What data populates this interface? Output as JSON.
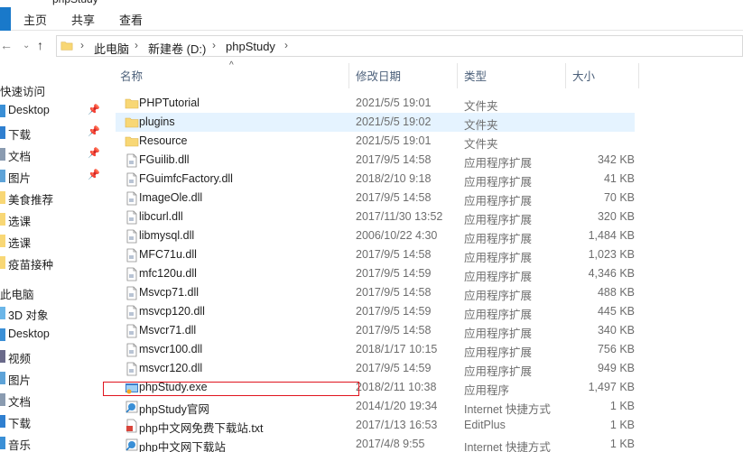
{
  "window": {
    "title": "phpStudy"
  },
  "ribbon": {
    "tabs": [
      "主页",
      "共享",
      "查看"
    ]
  },
  "address": {
    "crumbs": [
      "此电脑",
      "新建卷 (D:)",
      "phpStudy"
    ]
  },
  "nav": {
    "quick_access": "快速访问",
    "quick_items": [
      {
        "label": "Desktop",
        "pinned": true
      },
      {
        "label": "下载",
        "pinned": true
      },
      {
        "label": "文档",
        "pinned": true
      },
      {
        "label": "图片",
        "pinned": true
      },
      {
        "label": "美食推荐",
        "pinned": false
      },
      {
        "label": "选课",
        "pinned": false
      },
      {
        "label": "选课",
        "pinned": false
      },
      {
        "label": "疫苗接种",
        "pinned": false
      }
    ],
    "this_pc": "此电脑",
    "pc_items": [
      "3D 对象",
      "Desktop",
      "视频",
      "图片",
      "文档",
      "下载",
      "音乐"
    ]
  },
  "columns": {
    "name": "名称",
    "date": "修改日期",
    "type": "类型",
    "size": "大小"
  },
  "files": [
    {
      "name": "PHPTutorial",
      "date": "2021/5/5 19:01",
      "type": "文件夹",
      "size": "",
      "icon": "folder"
    },
    {
      "name": "plugins",
      "date": "2021/5/5 19:02",
      "type": "文件夹",
      "size": "",
      "icon": "folder"
    },
    {
      "name": "Resource",
      "date": "2021/5/5 19:01",
      "type": "文件夹",
      "size": "",
      "icon": "folder"
    },
    {
      "name": "FGuilib.dll",
      "date": "2017/9/5 14:58",
      "type": "应用程序扩展",
      "size": "342 KB",
      "icon": "dll"
    },
    {
      "name": "FGuimfcFactory.dll",
      "date": "2018/2/10 9:18",
      "type": "应用程序扩展",
      "size": "41 KB",
      "icon": "dll"
    },
    {
      "name": "ImageOle.dll",
      "date": "2017/9/5 14:58",
      "type": "应用程序扩展",
      "size": "70 KB",
      "icon": "dll"
    },
    {
      "name": "libcurl.dll",
      "date": "2017/11/30 13:52",
      "type": "应用程序扩展",
      "size": "320 KB",
      "icon": "dll"
    },
    {
      "name": "libmysql.dll",
      "date": "2006/10/22 4:30",
      "type": "应用程序扩展",
      "size": "1,484 KB",
      "icon": "dll"
    },
    {
      "name": "MFC71u.dll",
      "date": "2017/9/5 14:58",
      "type": "应用程序扩展",
      "size": "1,023 KB",
      "icon": "dll"
    },
    {
      "name": "mfc120u.dll",
      "date": "2017/9/5 14:59",
      "type": "应用程序扩展",
      "size": "4,346 KB",
      "icon": "dll"
    },
    {
      "name": "Msvcp71.dll",
      "date": "2017/9/5 14:58",
      "type": "应用程序扩展",
      "size": "488 KB",
      "icon": "dll"
    },
    {
      "name": "msvcp120.dll",
      "date": "2017/9/5 14:59",
      "type": "应用程序扩展",
      "size": "445 KB",
      "icon": "dll"
    },
    {
      "name": "Msvcr71.dll",
      "date": "2017/9/5 14:58",
      "type": "应用程序扩展",
      "size": "340 KB",
      "icon": "dll"
    },
    {
      "name": "msvcr100.dll",
      "date": "2018/1/17 10:15",
      "type": "应用程序扩展",
      "size": "756 KB",
      "icon": "dll"
    },
    {
      "name": "msvcr120.dll",
      "date": "2017/9/5 14:59",
      "type": "应用程序扩展",
      "size": "949 KB",
      "icon": "dll"
    },
    {
      "name": "phpStudy.exe",
      "date": "2018/2/11 10:38",
      "type": "应用程序",
      "size": "1,497 KB",
      "icon": "exe"
    },
    {
      "name": "phpStudy官网",
      "date": "2014/1/20 19:34",
      "type": "Internet 快捷方式",
      "size": "1 KB",
      "icon": "url"
    },
    {
      "name": "php中文网免费下载站.txt",
      "date": "2017/1/13 16:53",
      "type": "EditPlus",
      "size": "1 KB",
      "icon": "txt"
    },
    {
      "name": "php中文网下载站",
      "date": "2017/4/8 9:55",
      "type": "Internet 快捷方式",
      "size": "1 KB",
      "icon": "url"
    }
  ],
  "selected_index": 1,
  "colors": {
    "folder": "#f8d775",
    "highlight": "#e5f3ff",
    "accent": "#1979ca",
    "annotation": "#e0141e"
  }
}
